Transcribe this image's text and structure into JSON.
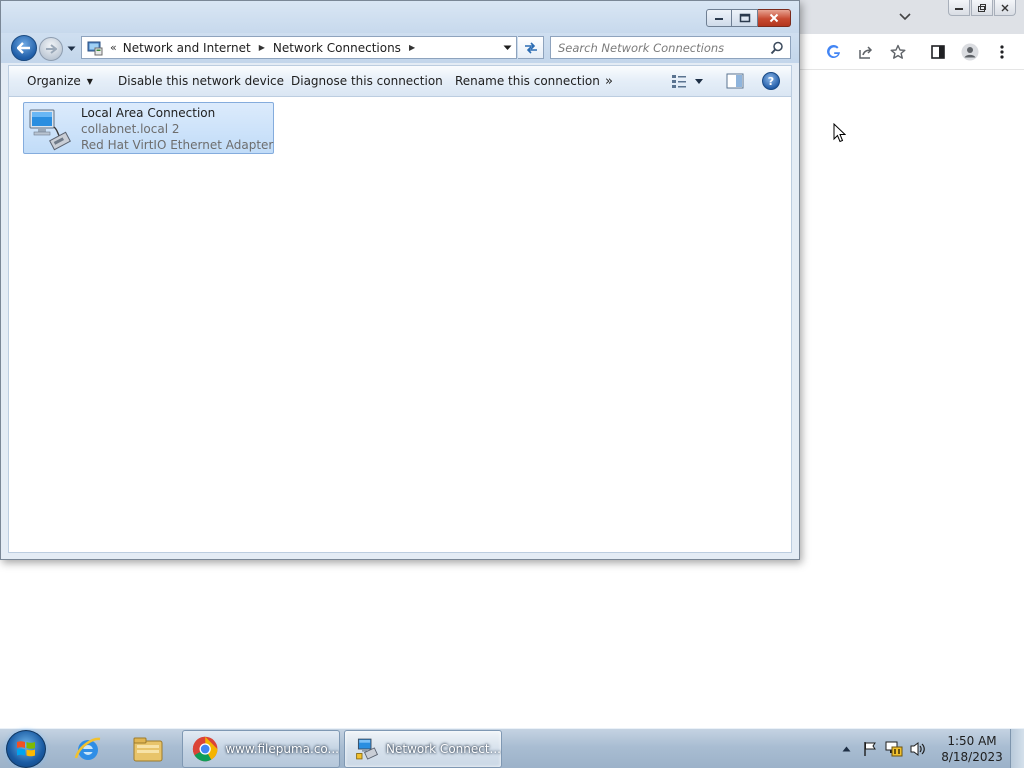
{
  "window": {
    "title": "Network Connections",
    "minimize_tip": "Minimize",
    "maximize_tip": "Maximize",
    "close_tip": "Close"
  },
  "address": {
    "overflow": "«",
    "crumbs": [
      "Network and Internet",
      "Network Connections"
    ]
  },
  "search": {
    "placeholder": "Search Network Connections"
  },
  "toolbar": {
    "organize": "Organize",
    "disable": "Disable this network device",
    "diagnose": "Diagnose this connection",
    "rename": "Rename this connection",
    "more": "»",
    "help": "?"
  },
  "connection": {
    "name": "Local Area Connection",
    "network": "collabnet.local  2",
    "device": "Red Hat VirtIO Ethernet Adapter",
    "selected": true
  },
  "taskbar": {
    "chrome_task": "www.filepuma.co...",
    "explorer_task": "Network Connect..."
  },
  "clock": {
    "time": "1:50 AM",
    "date": "8/18/2023"
  },
  "colors": {
    "selection": "#cce3fa",
    "taskbar": "#a9bdd2",
    "close": "#c74a31",
    "accent_blue": "#1f5ea8"
  }
}
